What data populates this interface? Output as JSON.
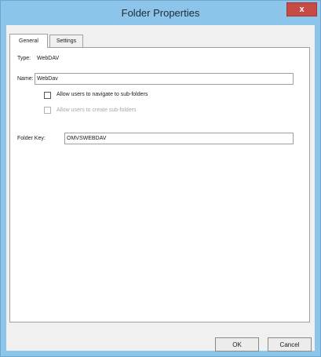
{
  "window": {
    "title": "Folder Properties",
    "close_glyph": "x"
  },
  "tabs": [
    {
      "label": "General",
      "active": true
    },
    {
      "label": "Settings",
      "active": false
    }
  ],
  "general": {
    "type_label": "Type:",
    "type_value": "WebDAV",
    "name_label": "Name:",
    "name_value": "WebDav",
    "allow_navigate_label": "Allow users to navigate to sub-folders",
    "allow_navigate_checked": false,
    "allow_create_label": "Allow users to create sub-folders",
    "allow_create_checked": false,
    "allow_create_enabled": false,
    "folder_key_label": "Folder Key:",
    "folder_key_value": "OMVSWEBDAV"
  },
  "buttons": {
    "ok": "OK",
    "cancel": "Cancel"
  },
  "colors": {
    "frame": "#8cc4ea",
    "close_button": "#c74a44"
  }
}
